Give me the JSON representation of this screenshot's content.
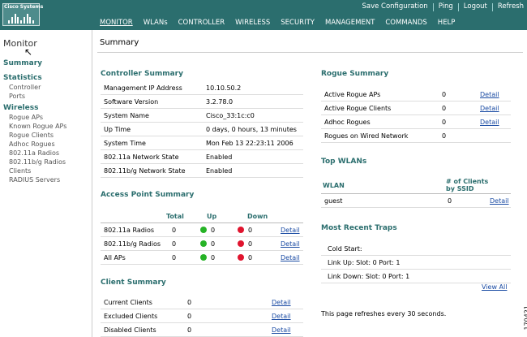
{
  "header": {
    "logo_text": "Cisco Systems",
    "top_links": [
      "Save Configuration",
      "Ping",
      "Logout",
      "Refresh"
    ],
    "menu": [
      "MONITOR",
      "WLANs",
      "CONTROLLER",
      "WIRELESS",
      "SECURITY",
      "MANAGEMENT",
      "COMMANDS",
      "HELP"
    ],
    "active_menu": "MONITOR"
  },
  "sidebar": {
    "title": "Monitor",
    "summary": "Summary",
    "statistics": {
      "label": "Statistics",
      "items": [
        "Controller",
        "Ports"
      ]
    },
    "wireless": {
      "label": "Wireless",
      "items": [
        "Rogue APs",
        "Known Rogue APs",
        "Rogue Clients",
        "Adhoc Rogues",
        "802.11a Radios",
        "802.11b/g Radios",
        "Clients",
        "RADIUS Servers"
      ]
    }
  },
  "page_title": "Summary",
  "controller_summary": {
    "title": "Controller Summary",
    "rows": [
      {
        "label": "Management IP Address",
        "value": "10.10.50.2"
      },
      {
        "label": "Software Version",
        "value": "3.2.78.0"
      },
      {
        "label": "System Name",
        "value": "Cisco_33:1c:c0"
      },
      {
        "label": "Up Time",
        "value": "0 days, 0 hours, 13 minutes"
      },
      {
        "label": "System Time",
        "value": "Mon Feb 13 22:23:11 2006"
      },
      {
        "label": "802.11a Network State",
        "value": "Enabled"
      },
      {
        "label": "802.11b/g Network State",
        "value": "Enabled"
      }
    ]
  },
  "ap_summary": {
    "title": "Access Point Summary",
    "headers": {
      "total": "Total",
      "up": "Up",
      "down": "Down"
    },
    "rows": [
      {
        "label": "802.11a Radios",
        "total": "0",
        "up": "0",
        "down": "0",
        "link": "Detail"
      },
      {
        "label": "802.11b/g Radios",
        "total": "0",
        "up": "0",
        "down": "0",
        "link": "Detail"
      },
      {
        "label": "All APs",
        "total": "0",
        "up": "0",
        "down": "0",
        "link": "Detail"
      }
    ]
  },
  "client_summary": {
    "title": "Client Summary",
    "rows": [
      {
        "label": "Current Clients",
        "value": "0",
        "link": "Detail"
      },
      {
        "label": "Excluded Clients",
        "value": "0",
        "link": "Detail"
      },
      {
        "label": "Disabled Clients",
        "value": "0",
        "link": "Detail"
      }
    ]
  },
  "rogue_summary": {
    "title": "Rogue Summary",
    "rows": [
      {
        "label": "Active Rogue APs",
        "value": "0",
        "link": "Detail"
      },
      {
        "label": "Active Rogue Clients",
        "value": "0",
        "link": "Detail"
      },
      {
        "label": "Adhoc Rogues",
        "value": "0",
        "link": "Detail"
      },
      {
        "label": "Rogues on Wired Network",
        "value": "0",
        "link": ""
      }
    ]
  },
  "top_wlans": {
    "title": "Top WLANs",
    "col_wlan": "WLAN",
    "col_clients_line1": "# of Clients",
    "col_clients_line2": "by SSID",
    "rows": [
      {
        "wlan": "guest",
        "clients": "0",
        "link": "Detail"
      }
    ]
  },
  "traps": {
    "title": "Most Recent Traps",
    "rows": [
      "Cold Start:",
      "Link Up: Slot: 0 Port: 1",
      "Link Down: Slot: 0 Port: 1"
    ],
    "view_all": "View All"
  },
  "refresh_note": "This page refreshes every 30 seconds.",
  "figure_code": "170421",
  "colors": {
    "header": "#2b6e6e",
    "section": "#2b6e6e",
    "link": "#1a4ba3",
    "up": "#26b326",
    "down": "#e0142e"
  }
}
